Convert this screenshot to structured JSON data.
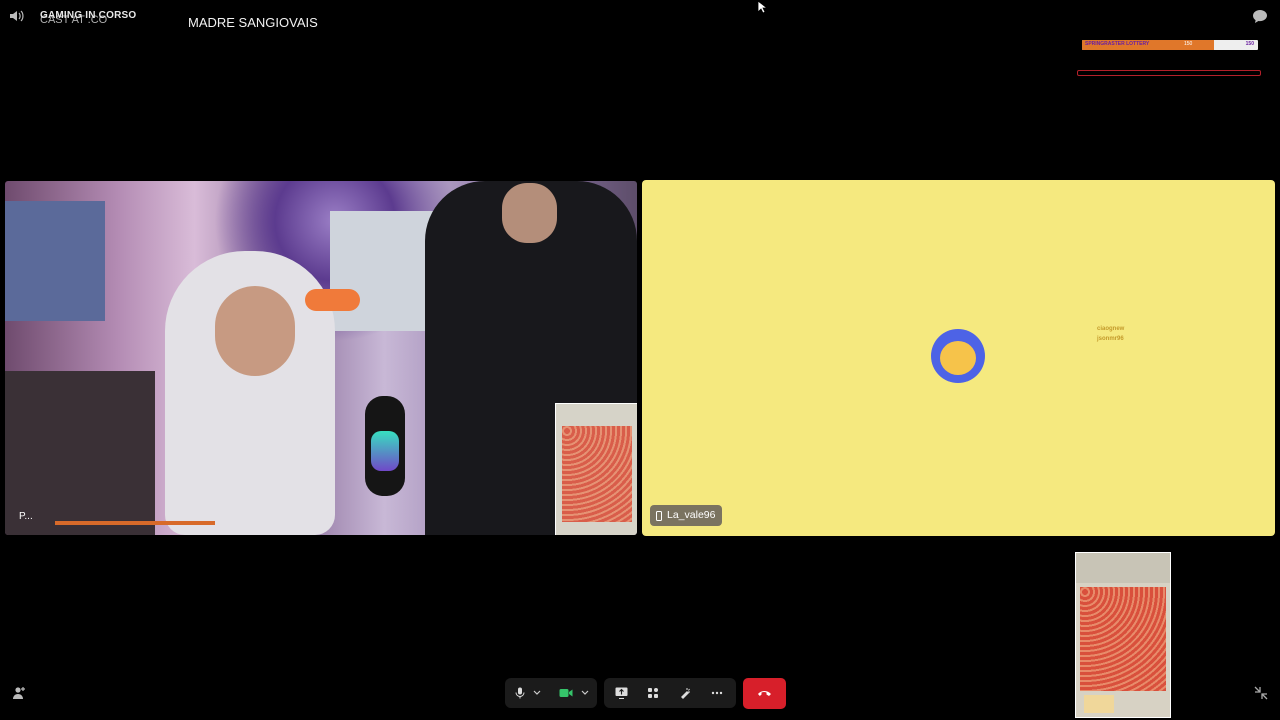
{
  "top": {
    "overlay_text": "GAMING IN CORSO",
    "overlay_sub": "CAST AT .CO",
    "channel_title": "MADRE SANGIOVAIS"
  },
  "lottery": {
    "label": "SPRINGRASTER LOTTERY",
    "mid_value": "150",
    "value": "150",
    "progress": 0.75,
    "fill_color": "#e0772a"
  },
  "tiles": {
    "left": {
      "name": "P..."
    },
    "right": {
      "name": "La_vale96",
      "background": "#f5e97f",
      "chat": [
        {
          "user": "ciaognew",
          "text": ""
        },
        {
          "user": "jsonmr96",
          "text": ""
        }
      ]
    }
  },
  "controls": {
    "mic_icon": "mic-icon",
    "camera_icon": "camera-icon",
    "end_call_color": "#d71f2a"
  }
}
